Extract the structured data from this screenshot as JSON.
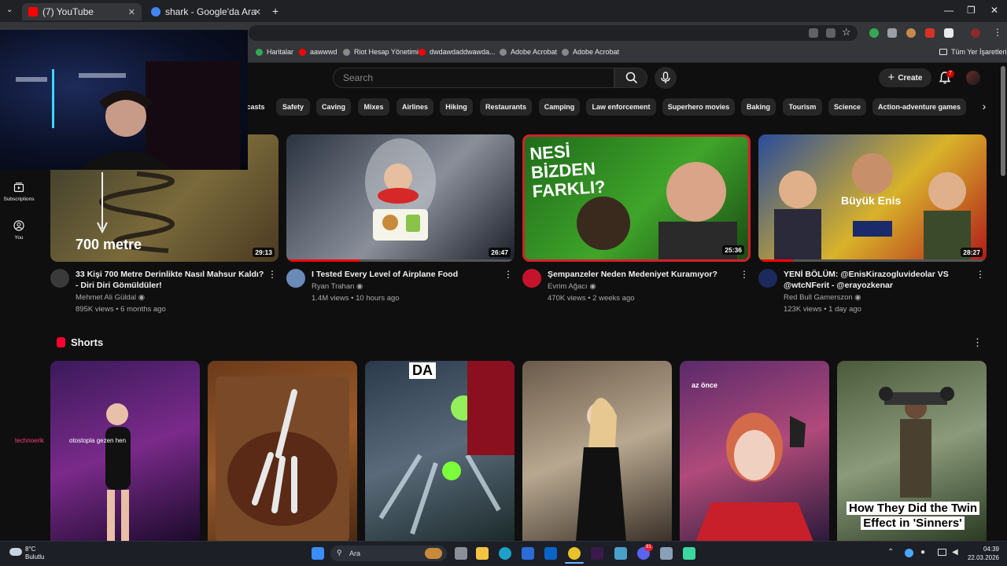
{
  "browser": {
    "tabs": [
      {
        "title": "(7) YouTube",
        "favicon_color": "#ff0000",
        "active": true
      },
      {
        "title": "shark - Google'da Ara",
        "favicon_color": "#4285f4",
        "active": false
      }
    ],
    "new_tab": "+",
    "window_controls": [
      "—",
      "❐",
      "✕"
    ],
    "bookmarks": [
      {
        "label": "Haritalar",
        "icon_color": "#34a853"
      },
      {
        "label": "aawwwd",
        "icon_color": "#ff0000"
      },
      {
        "label": "Riot Hesap Yönetimi",
        "icon_color": "#888888"
      },
      {
        "label": "dwdawdaddwawda...",
        "icon_color": "#ff0000"
      },
      {
        "label": "Adobe Acrobat",
        "icon_color": "#888888"
      },
      {
        "label": "Adobe Acrobat",
        "icon_color": "#888888"
      }
    ],
    "all_bookmarks": "Tüm Yer İşaretleri"
  },
  "youtube": {
    "search_placeholder": "Search",
    "create_label": "Create",
    "notification_count": "7",
    "chips": [
      "casts",
      "Safety",
      "Caving",
      "Mixes",
      "Airlines",
      "Hiking",
      "Restaurants",
      "Camping",
      "Law enforcement",
      "Superhero movies",
      "Baking",
      "Tourism",
      "Science",
      "Action-adventure games"
    ],
    "sidenav": [
      {
        "label": "Subscriptions",
        "icon": "subscriptions-icon"
      },
      {
        "label": "You",
        "icon": "user-icon"
      }
    ],
    "videos": [
      {
        "title": "33 Kişi 700 Metre Derinlikte Nasıl Mahsur Kaldı? - Diri Diri Gömüldüler!",
        "channel": "Mehmet Ali Güldal",
        "verified": true,
        "stats": "895K views • 6 months ago",
        "duration": "29:13",
        "overlay_text": "700 metre",
        "thumb_colors": [
          "#3a3a2a",
          "#7a6a3a",
          "#4a3a22"
        ],
        "avatar_color": "#3a3a3a",
        "progress": 0
      },
      {
        "title": "I Tested Every Level of Airplane Food",
        "channel": "Ryan Trahan",
        "verified": true,
        "stats": "1.4M views • 10 hours ago",
        "duration": "26:47",
        "overlay_text": "",
        "thumb_colors": [
          "#2b3340",
          "#8a8f9a",
          "#1a1f28"
        ],
        "avatar_color": "#6a8ab8",
        "progress": 0.32
      },
      {
        "title": "Şempanzeler Neden Medeniyet Kuramıyor?",
        "channel": "Evrim Ağacı",
        "verified": true,
        "stats": "470K views • 2 weeks ago",
        "duration": "25:36",
        "overlay_text": "NESİ BİZDEN FARKLI?",
        "thumb_colors": [
          "#1f6b1a",
          "#3fa52a",
          "#1a4a14"
        ],
        "avatar_color": "#c4142b",
        "progress": 0
      },
      {
        "title": "YENİ BÖLÜM: @EnisKirazogluvideolar VS @wtcNFerit - @erayozkenar",
        "channel": "Red Bull Gamerszon",
        "verified": true,
        "stats": "123K views • 1 day ago",
        "duration": "28:27",
        "overlay_text": "Büyük Enis",
        "thumb_colors": [
          "#2a4c9a",
          "#d8b22a",
          "#b01a1a"
        ],
        "avatar_color": "#1b2a5a",
        "progress": 0.15
      }
    ],
    "shorts_title": "Shorts",
    "shorts": [
      {
        "caption": "otostopla gezen hen",
        "prefix": "technoerik",
        "colors": [
          "#3a1a5a",
          "#7a2a8a",
          "#1a0a2a"
        ]
      },
      {
        "caption": "",
        "prefix": "",
        "colors": [
          "#6a3a1a",
          "#9a5a2a",
          "#4a2a12"
        ]
      },
      {
        "caption": "DA",
        "prefix": "",
        "colors": [
          "#2a3a4a",
          "#5a6a7a",
          "#1a2a2a"
        ]
      },
      {
        "caption": "",
        "prefix": "",
        "colors": [
          "#6a5a4a",
          "#b8a890",
          "#3a3028"
        ]
      },
      {
        "caption": "az önce",
        "prefix": "",
        "colors": [
          "#5a2a6a",
          "#b04a7a",
          "#2a1a3a"
        ]
      },
      {
        "caption": "How They Did the Twin Effect in 'Sinners'",
        "prefix": "",
        "colors": [
          "#4a5a3a",
          "#8a9a7a",
          "#2a3a22"
        ]
      }
    ]
  },
  "taskbar": {
    "weather_temp": "8°C",
    "weather_desc": "Bulutlu",
    "search_label": "Ara",
    "time": "04:39",
    "date": "22.03.2026",
    "discord_badge": "91"
  }
}
